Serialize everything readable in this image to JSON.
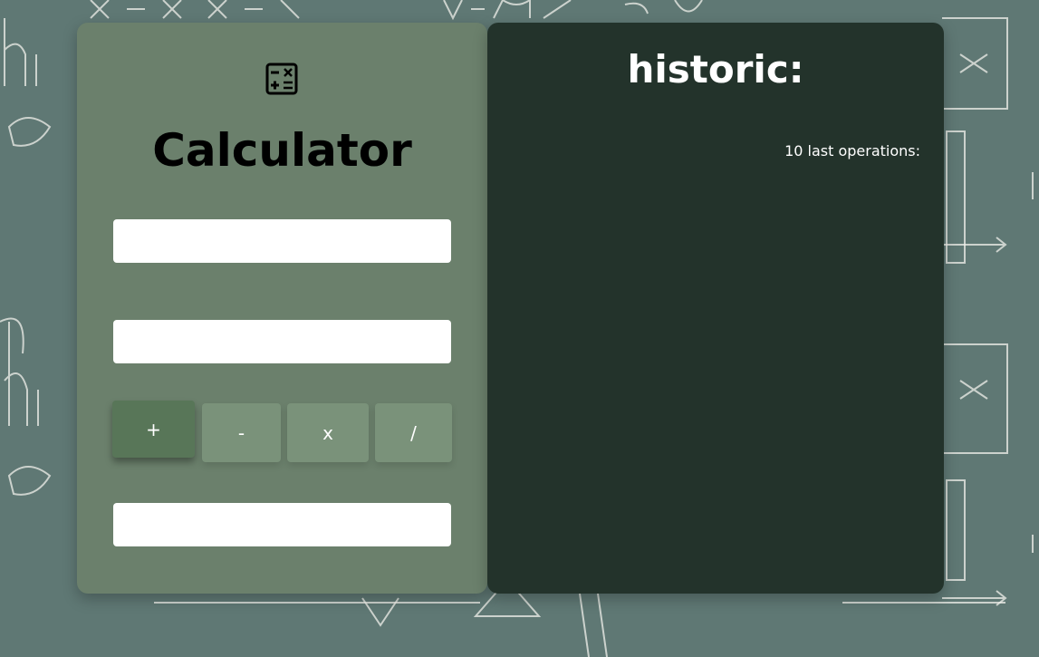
{
  "colors": {
    "background": "#5f7874",
    "calculator_card": "#6b806c",
    "historic_card": "#23332b",
    "button": "#7a927a",
    "button_active": "#587658"
  },
  "calculator": {
    "icon": "calculator-icon",
    "title": "Calculator",
    "first_value": "",
    "second_value": "",
    "result": "",
    "operators": {
      "add": "+",
      "subtract": "-",
      "multiply": "x",
      "divide": "/"
    },
    "active_operator": "add"
  },
  "historic": {
    "title": "historic:",
    "subtitle": "10 last operations:",
    "operations": []
  }
}
